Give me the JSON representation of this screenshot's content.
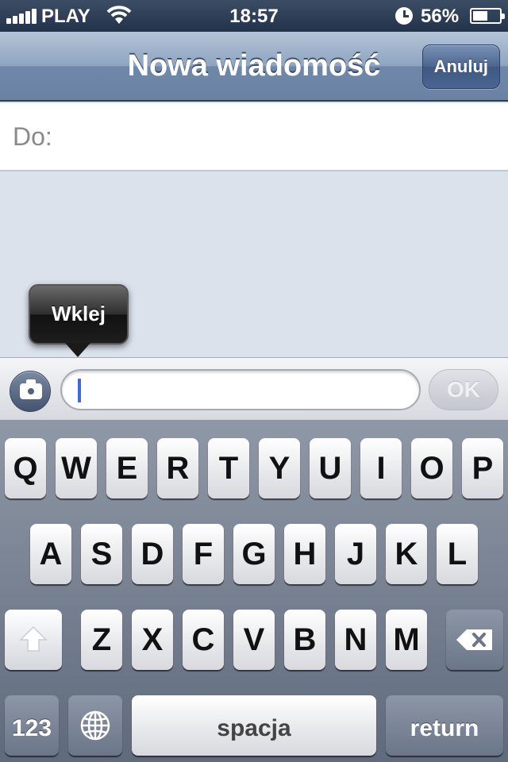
{
  "status_bar": {
    "carrier": "PLAY",
    "time": "18:57",
    "battery_percent_text": "56%",
    "battery_level": 0.56,
    "signal_icon": "signal-bars-icon",
    "wifi_icon": "wifi-icon",
    "clock_icon": "alarm-clock-icon"
  },
  "nav": {
    "title": "Nowa wiadomość",
    "cancel_label": "Anuluj"
  },
  "recipient": {
    "label": "Do:"
  },
  "paste_popup": {
    "label": "Wklej"
  },
  "compose": {
    "camera_icon": "camera-icon",
    "input_value": "",
    "send_label": "OK"
  },
  "keyboard": {
    "row1": [
      "Q",
      "W",
      "E",
      "R",
      "T",
      "Y",
      "U",
      "I",
      "O",
      "P"
    ],
    "row2": [
      "A",
      "S",
      "D",
      "F",
      "G",
      "H",
      "J",
      "K",
      "L"
    ],
    "row3": [
      "Z",
      "X",
      "C",
      "V",
      "B",
      "N",
      "M"
    ],
    "numbers_label": "123",
    "space_label": "spacja",
    "return_label": "return",
    "shift_icon": "shift-arrow-icon",
    "backspace_icon": "backspace-icon",
    "globe_icon": "globe-icon"
  },
  "colors": {
    "nav_bar": "#7a90b0",
    "cursor": "#3c6cdc",
    "keyboard_bg": "#6f7a8c"
  }
}
